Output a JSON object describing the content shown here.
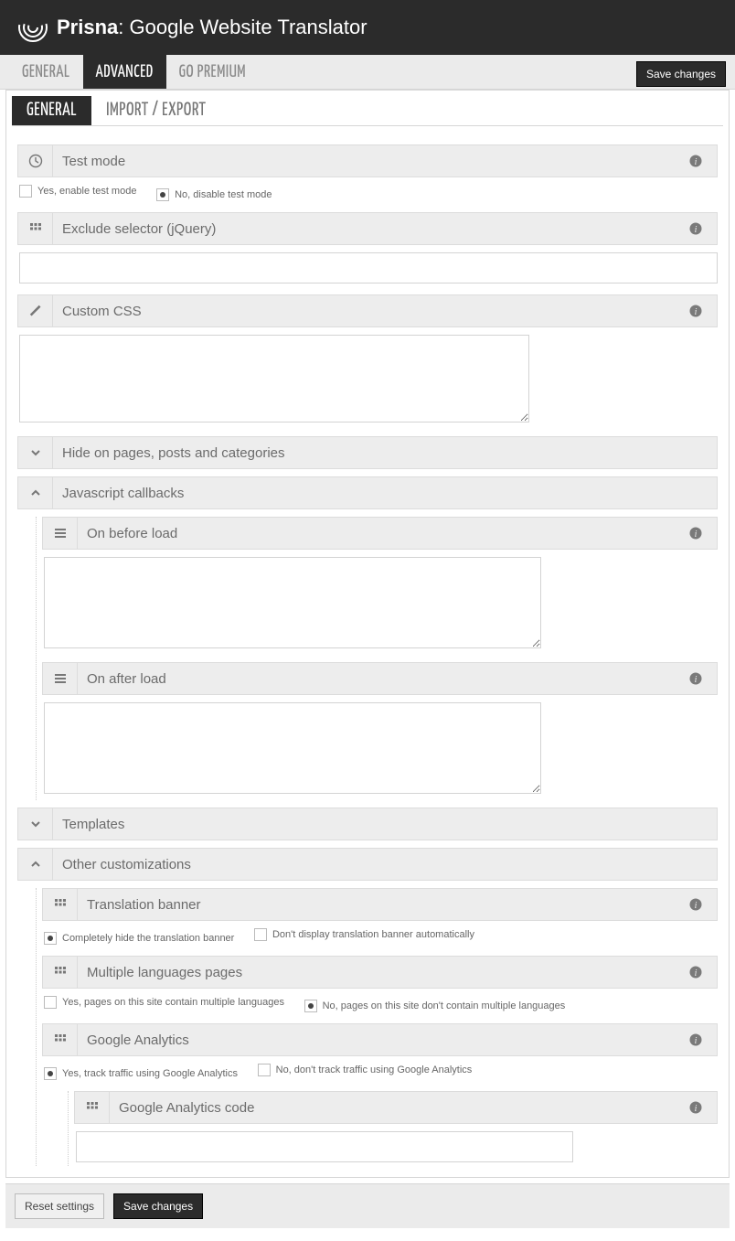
{
  "header": {
    "brand": "Prisna",
    "title": "Google Website Translator"
  },
  "topTabs": {
    "general": "General",
    "advanced": "Advanced",
    "premium": "Go Premium"
  },
  "buttons": {
    "save": "Save changes",
    "reset": "Reset settings"
  },
  "subTabs": {
    "general": "General",
    "import": "Import / Export"
  },
  "fields": {
    "testMode": {
      "title": "Test mode",
      "optYes": "Yes, enable test mode",
      "optNo": "No, disable test mode"
    },
    "exclude": {
      "title": "Exclude selector (jQuery)",
      "value": ""
    },
    "customCss": {
      "title": "Custom CSS",
      "value": ""
    },
    "hidePages": {
      "title": "Hide on pages, posts and categories"
    },
    "jsCallbacks": {
      "title": "Javascript callbacks",
      "before": {
        "title": "On before load",
        "value": ""
      },
      "after": {
        "title": "On after load",
        "value": ""
      }
    },
    "templates": {
      "title": "Templates"
    },
    "other": {
      "title": "Other customizations",
      "banner": {
        "title": "Translation banner",
        "opt1": "Completely hide the translation banner",
        "opt2": "Don't display translation banner automatically"
      },
      "multi": {
        "title": "Multiple languages pages",
        "opt1": "Yes, pages on this site contain multiple languages",
        "opt2": "No, pages on this site don't contain multiple languages"
      },
      "ga": {
        "title": "Google Analytics",
        "opt1": "Yes, track traffic using Google Analytics",
        "opt2": "No, don't track traffic using Google Analytics",
        "code": {
          "title": "Google Analytics code",
          "value": ""
        }
      }
    }
  }
}
